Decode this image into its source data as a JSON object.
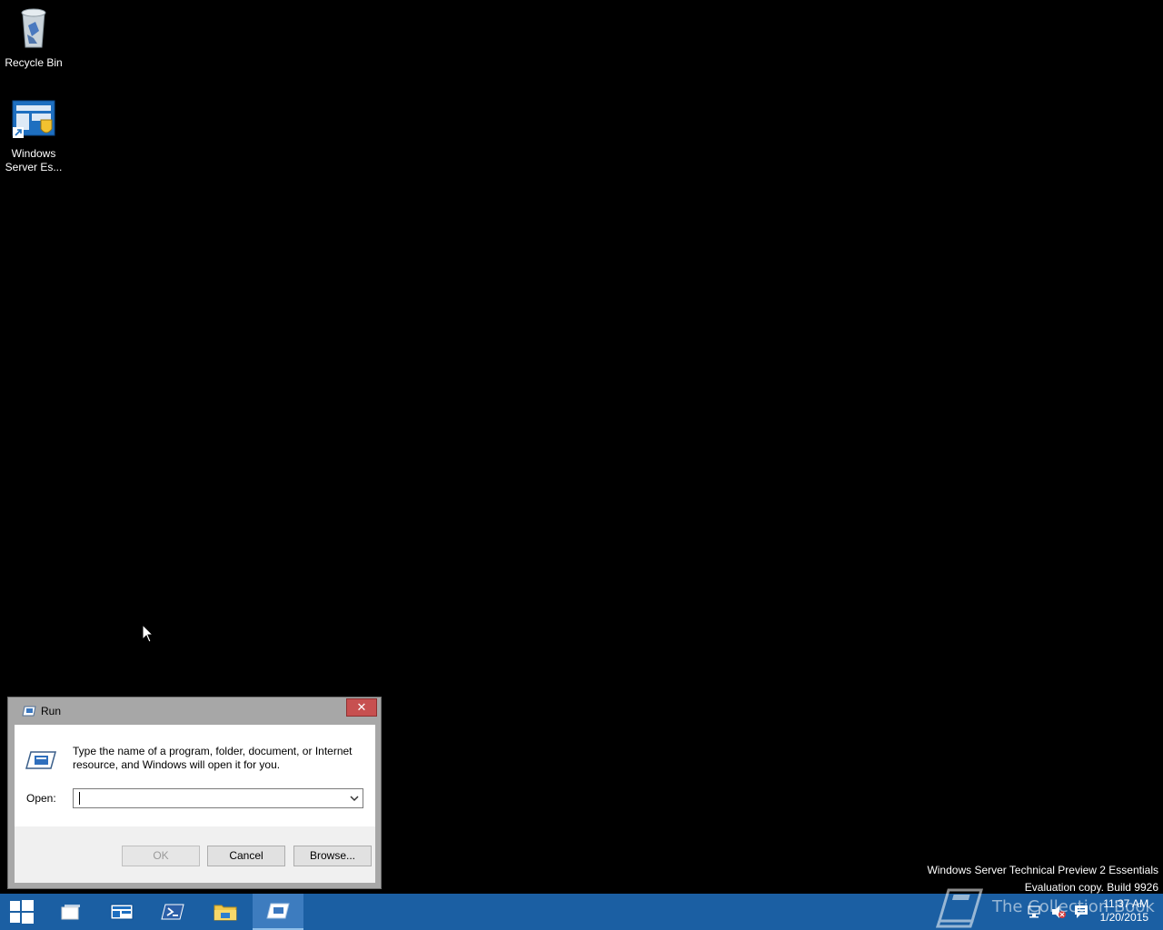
{
  "desktop": {
    "icons": [
      {
        "label": "Recycle Bin",
        "icon": "recycle-bin-icon"
      },
      {
        "label": "Windows Server Es...",
        "icon": "windows-server-essentials-icon"
      }
    ]
  },
  "run_dialog": {
    "title": "Run",
    "close_label": "✕",
    "description": "Type the name of a program, folder, document, or Internet resource, and Windows will open it for you.",
    "open_label": "Open:",
    "open_value": "",
    "ok_label": "OK",
    "cancel_label": "Cancel",
    "browse_label": "Browse..."
  },
  "watermark": {
    "line1": "Windows Server Technical Preview 2 Essentials",
    "line2": "Evaluation copy. Build 9926"
  },
  "overlay": {
    "brand_text": "The Collection Book"
  },
  "taskbar": {
    "buttons": [
      {
        "icon": "windows-start-icon"
      },
      {
        "icon": "task-view-icon"
      },
      {
        "icon": "server-manager-icon"
      },
      {
        "icon": "powershell-icon"
      },
      {
        "icon": "file-explorer-icon"
      },
      {
        "icon": "run-icon",
        "active": true
      }
    ],
    "clock": {
      "time": "11:37 AM",
      "date": "1/20/2015"
    },
    "colors": {
      "taskbar": "#1b5fa3",
      "active": "#3d7cbf"
    }
  }
}
